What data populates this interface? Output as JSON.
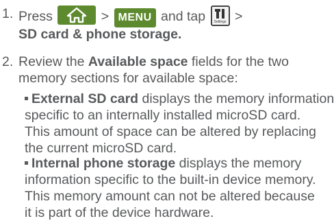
{
  "step1": {
    "number": "1.",
    "press": "Press",
    "sep1": ">",
    "menu_key": "MENU",
    "and_tap": "and tap",
    "settings_caption": "Settings",
    "sep2": ">",
    "path": "SD card & phone storage."
  },
  "step2": {
    "number": "2.",
    "line1_pre": "Review the ",
    "line1_bold": "Available space",
    "line1_post": " fields for the two",
    "line2": "memory sections for available space:",
    "bullets": [
      {
        "bold": "External SD card",
        "lines": [
          " displays the memory information",
          "specific to an internally installed microSD card.",
          "This amount of space can be altered by replacing",
          "the current microSD card."
        ]
      },
      {
        "bold": "Internal phone storage",
        "lines": [
          " displays the memory",
          "information specific to the built-in device memory.",
          "This memory amount can not be altered because",
          "it is part of the device hardware."
        ]
      }
    ]
  },
  "colors": {
    "text": "#58595b",
    "key_green": "#5e8a2f"
  },
  "icons": [
    "home-icon",
    "settings-icon"
  ]
}
